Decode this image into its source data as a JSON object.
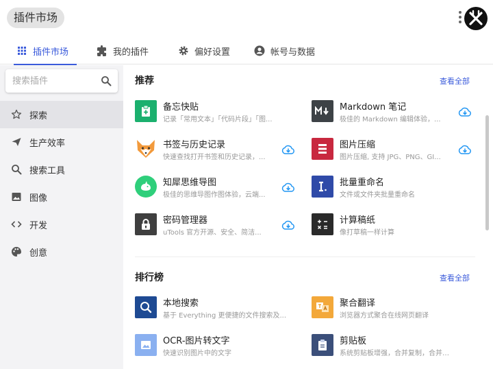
{
  "app": {
    "title": "插件市场"
  },
  "tabs": [
    {
      "label": "插件市场",
      "icon": "grid-icon"
    },
    {
      "label": "我的插件",
      "icon": "puzzle-icon"
    },
    {
      "label": "偏好设置",
      "icon": "gear-icon"
    },
    {
      "label": "帐号与数据",
      "icon": "account-icon"
    }
  ],
  "search": {
    "placeholder": "搜索插件"
  },
  "sidebar": {
    "items": [
      {
        "label": "探索",
        "icon": "star-icon"
      },
      {
        "label": "生产效率",
        "icon": "send-icon"
      },
      {
        "label": "搜索工具",
        "icon": "search-icon"
      },
      {
        "label": "图像",
        "icon": "image-icon"
      },
      {
        "label": "开发",
        "icon": "code-icon"
      },
      {
        "label": "创意",
        "icon": "palette-icon"
      }
    ]
  },
  "sections": {
    "recommend": {
      "title": "推荐",
      "view_all": "查看全部",
      "plugins": [
        {
          "name": "备忘快贴",
          "desc": "记录「常用文本」「代码片段」「图...",
          "icon": "clipboard-plus-icon",
          "color": "#1bb06e"
        },
        {
          "name": "Markdown 笔记",
          "desc": "极佳的 Markdown 编辑体验，...",
          "icon": "markdown-icon",
          "color": "#3d4246"
        },
        {
          "name": "书签与历史记录",
          "desc": "快速查找打开书签和历史记录，...",
          "icon": "fox-icon",
          "color": "#f29a3c"
        },
        {
          "name": "图片压缩",
          "desc": "图片压缩, 支持 JPG、PNG、GI...",
          "icon": "stack-icon",
          "color": "#c8283f"
        },
        {
          "name": "知犀思维导图",
          "desc": "极佳的思维导图作图体验，云端...",
          "icon": "rhino-icon",
          "color": "#2fcf7b"
        },
        {
          "name": "批量重命名",
          "desc": "文件或文件夹批量重命名",
          "icon": "rename-icon",
          "color": "#2f4aa8"
        },
        {
          "name": "密码管理器",
          "desc": "uTools 官方开源、安全、简洁...",
          "icon": "lock-icon",
          "color": "#3f3f3f"
        },
        {
          "name": "计算稿纸",
          "desc": "像打草稿一样计算",
          "icon": "calculator-icon",
          "color": "#2a2a2a"
        }
      ]
    },
    "ranking": {
      "title": "排行榜",
      "view_all": "查看全部",
      "plugins": [
        {
          "name": "本地搜索",
          "desc": "基于 Everything 更便捷的文件搜索及...",
          "icon": "magnifier-icon",
          "color": "#1e4a93"
        },
        {
          "name": "聚合翻译",
          "desc": "浏览器方式聚合在线网页翻译",
          "icon": "translate-icon",
          "color": "#f3a83a"
        },
        {
          "name": "OCR-图片转文字",
          "desc": "快速识别图片中的文字",
          "icon": "image-text-icon",
          "color": "#8ab0f0"
        },
        {
          "name": "剪贴板",
          "desc": "系统剪贴板增强，合并复制，合并一...",
          "icon": "clipboard-icon",
          "color": "#3b4f7a"
        }
      ]
    }
  }
}
